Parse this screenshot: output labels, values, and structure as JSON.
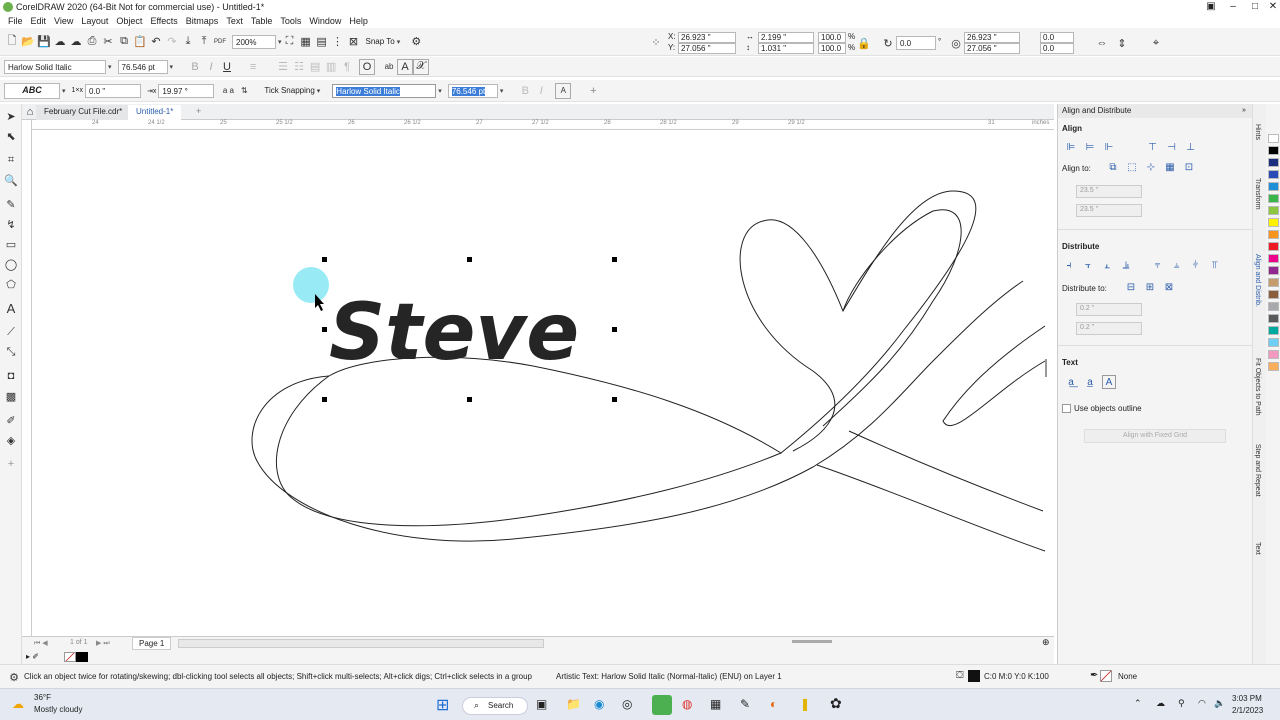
{
  "window": {
    "title": "CorelDRAW 2020 (64-Bit Not for commercial use) - Untitled-1*"
  },
  "menu": [
    "File",
    "Edit",
    "View",
    "Layout",
    "Object",
    "Effects",
    "Bitmaps",
    "Text",
    "Table",
    "Tools",
    "Window",
    "Help"
  ],
  "toolbar": {
    "zoom": "200%",
    "snap_label": "Snap To",
    "x": "26.923 \"",
    "y": "27.056 \"",
    "w": "2.199 \"",
    "h": "1.031 \"",
    "scale_x": "100.0",
    "scale_y": "100.0",
    "pct": "%",
    "rotation": "0.0",
    "pos2_x": "26.923 \"",
    "pos2_y": "27.056 \"",
    "skew_x": "0.0",
    "skew_y": "0.0"
  },
  "propbar": {
    "font": "Harlow Solid Italic",
    "size": "76.546 pt"
  },
  "textbar": {
    "abc_label": "ABC",
    "offset": "0.0 \"",
    "spacing": "19.97 °",
    "tick_snapping": "Tick Snapping",
    "font_sel": "Harlow Solid Italic",
    "size_sel": "76.546 pt"
  },
  "tabs": {
    "file1": "February Cut File.cdr*",
    "file2": "Untitled-1*"
  },
  "ruler": {
    "labels": [
      "24",
      "24 1/2",
      "25",
      "25 1/2",
      "26",
      "26 1/2",
      "27",
      "27 1/2",
      "28",
      "28 1/2",
      "29",
      "29 1/2",
      "31"
    ],
    "unit": "inches"
  },
  "canvas": {
    "text": "Steve"
  },
  "pagebar": {
    "pager": "1 of 1",
    "page": "Page 1"
  },
  "status": {
    "hint": "Click an object twice for rotating/skewing; dbl-clicking tool selects all objects; Shift+click multi-selects; Alt+click digs; Ctrl+click selects in a group",
    "object": "Artistic Text: Harlow Solid Italic (Normal-Italic) (ENU) on Layer 1",
    "fill": "C:0 M:0 Y:0 K:100",
    "outline": "None"
  },
  "docker": {
    "title": "Align and Distribute",
    "align": "Align",
    "align_to": "Align to:",
    "pos_x": "23.5 \"",
    "pos_y": "23.5 \"",
    "distribute": "Distribute",
    "distribute_to": "Distribute to:",
    "dist_x": "0.2 \"",
    "dist_y": "0.2 \"",
    "text": "Text",
    "use_outline": "Use objects outline",
    "align_grid": "Align with Fixed Grid"
  },
  "vtabs": [
    "Hints",
    "Transform",
    "Align and Distrib.",
    "Fit Objects to Path",
    "Step and Repeat",
    "Text"
  ],
  "palette": [
    "#ffffff",
    "#000000",
    "#1b2f7e",
    "#2a4ab5",
    "#1f8fd8",
    "#39b54a",
    "#8cc63f",
    "#fff200",
    "#f7941d",
    "#ed1c24",
    "#ec008c",
    "#92278f",
    "#c69c6d",
    "#8b5e3c",
    "#a7a9ac",
    "#58595b",
    "#00a99d",
    "#6dcff6",
    "#f49ac1",
    "#fbaf5d"
  ],
  "taskbar": {
    "temp": "36°F",
    "weather": "Mostly cloudy",
    "search": "Search",
    "time": "3:03 PM",
    "date": "2/1/2023"
  }
}
